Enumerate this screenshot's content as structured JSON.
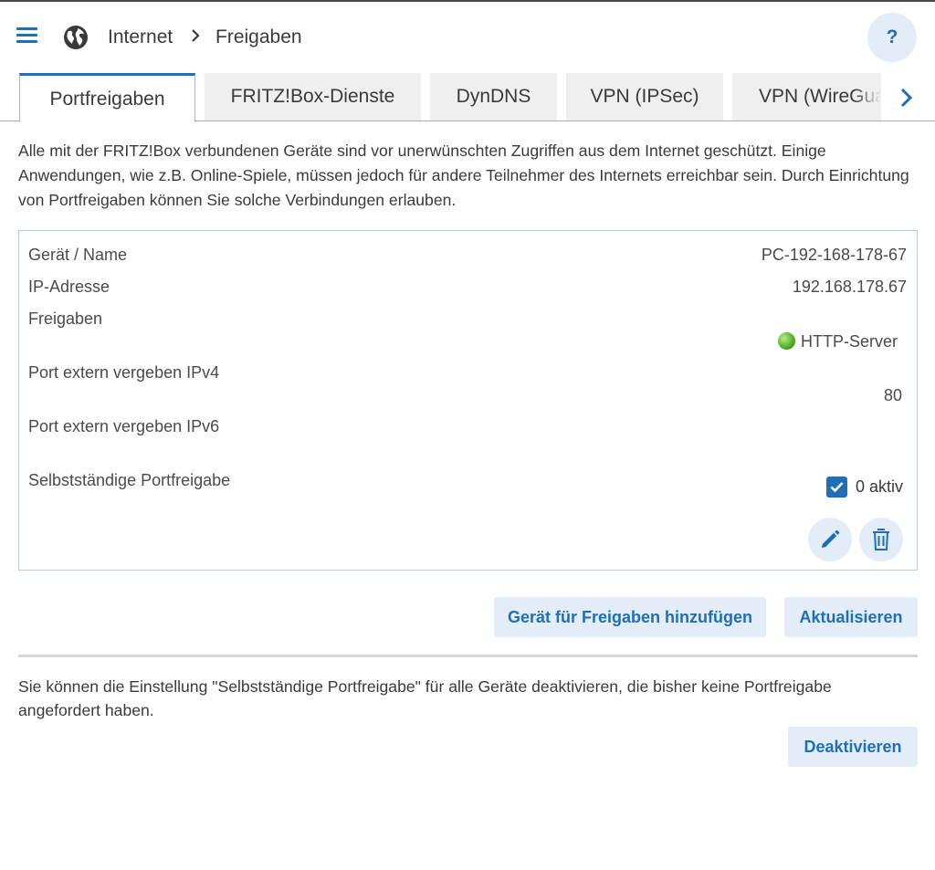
{
  "header": {
    "breadcrumb": [
      "Internet",
      "Freigaben"
    ],
    "help_label": "?"
  },
  "tabs": [
    {
      "label": "Portfreigaben",
      "active": true
    },
    {
      "label": "FRITZ!Box-Dienste",
      "active": false
    },
    {
      "label": "DynDNS",
      "active": false
    },
    {
      "label": "VPN (IPSec)",
      "active": false
    },
    {
      "label": "VPN (WireGuard)",
      "active": false
    }
  ],
  "intro_text": "Alle mit der FRITZ!Box verbundenen Geräte sind vor unerwünschten Zugriffen aus dem Internet geschützt. Einige Anwendungen, wie z.B. Online-Spiele, müssen jedoch für andere Teilnehmer des Internets erreichbar sein. Durch Einrichtung von Portfreigaben können Sie solche Verbindungen erlauben.",
  "device": {
    "name_label": "Gerät / Name",
    "name_value": "PC-192-168-178-67",
    "ip_label": "IP-Adresse",
    "ip_value": "192.168.178.67",
    "shares_label": "Freigaben",
    "share_name": "HTTP-Server",
    "share_status_color": "#4caf1e",
    "port_ipv4_label": "Port extern vergeben IPv4",
    "port_ipv4_value": "80",
    "port_ipv6_label": "Port extern vergeben IPv6",
    "port_ipv6_value": "",
    "self_share_label": "Selbstständige Portfreigabe",
    "self_share_checked": true,
    "self_share_value": "0 aktiv"
  },
  "buttons": {
    "add_device": "Gerät für Freigaben hinzufügen",
    "refresh": "Aktualisieren",
    "deactivate": "Deaktivieren"
  },
  "info_text": "Sie können die Einstellung \"Selbstständige Portfreigabe\" für alle Geräte deaktivieren, die bisher keine Portfreigabe angefordert haben.",
  "colors": {
    "accent": "#1f6fb8",
    "button_bg": "#e2edf7",
    "tab_inactive_bg": "#efefef"
  },
  "icons": [
    "menu-icon",
    "globe-icon",
    "chevron-right-icon",
    "check-icon",
    "pencil-icon",
    "trash-icon"
  ]
}
